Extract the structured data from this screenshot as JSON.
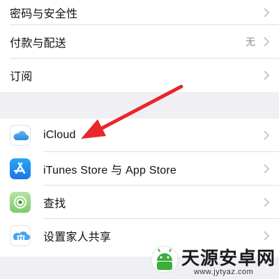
{
  "settings_top": {
    "items": [
      {
        "label": "密码与安全性",
        "value": ""
      },
      {
        "label": "付款与配送",
        "value": "无"
      },
      {
        "label": "订阅",
        "value": ""
      }
    ]
  },
  "settings_apps": {
    "items": [
      {
        "label": "iCloud",
        "icon": "icloud-icon"
      },
      {
        "label": "iTunes Store 与 App Store",
        "icon": "app-store-icon"
      },
      {
        "label": "查找",
        "icon": "find-my-icon"
      },
      {
        "label": "设置家人共享",
        "icon": "family-sharing-icon"
      }
    ]
  },
  "watermark": {
    "title": "天源安卓网",
    "url": "www.jytyaz.com"
  },
  "colors": {
    "background": "#efeff4",
    "arrow": "#e8262b",
    "chevron": "#c7c7cc"
  }
}
